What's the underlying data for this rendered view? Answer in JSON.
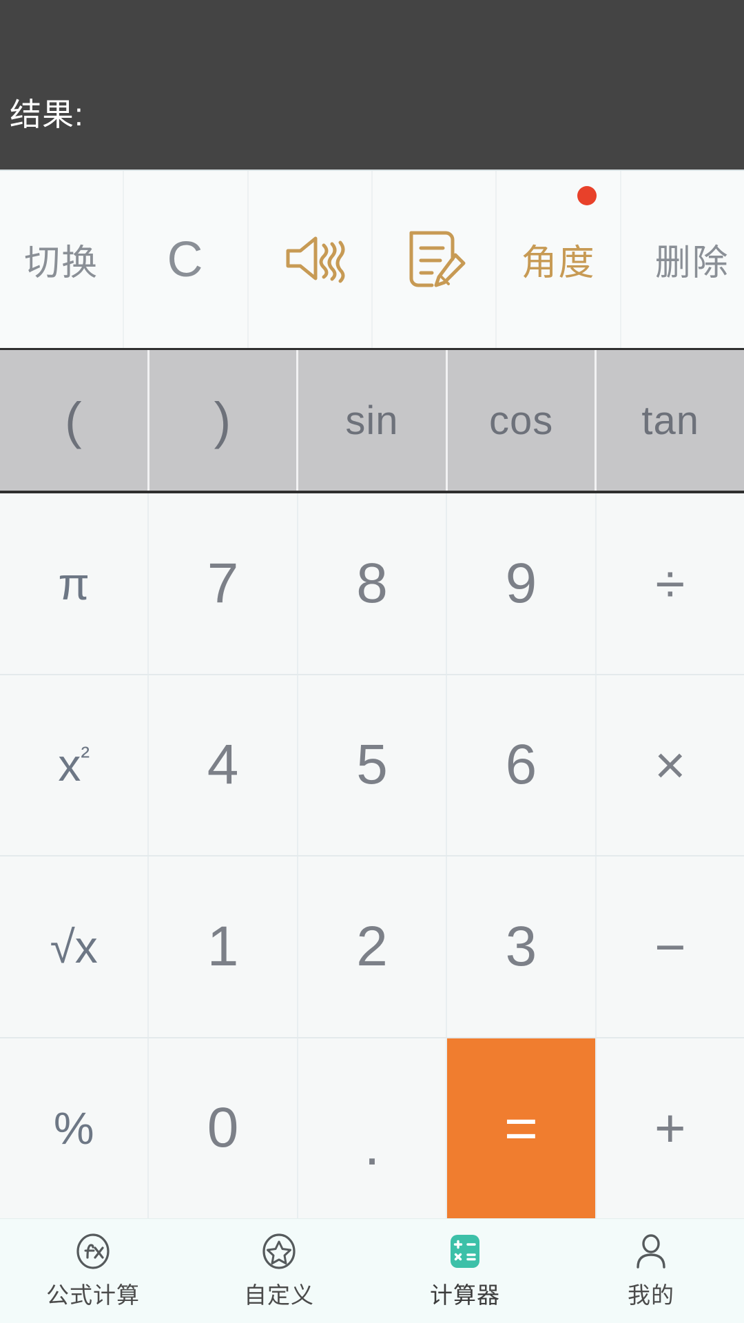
{
  "app": {
    "title": "计算器"
  },
  "display": {
    "expression": "",
    "result_label": "结果:"
  },
  "toolbar": {
    "items": [
      {
        "label": "切换",
        "type": "text",
        "icon": "",
        "style": "gray",
        "badge": false
      },
      {
        "label": "C",
        "type": "text",
        "icon": "",
        "style": "clear",
        "badge": false
      },
      {
        "label": "",
        "type": "icon",
        "icon": "sound-icon",
        "style": "gold",
        "badge": false
      },
      {
        "label": "",
        "type": "icon",
        "icon": "note-edit-icon",
        "style": "gold",
        "badge": false
      },
      {
        "label": "角度",
        "type": "text",
        "icon": "",
        "style": "gold",
        "badge": true
      },
      {
        "label": "删除",
        "type": "text",
        "icon": "",
        "style": "delete",
        "badge": false
      }
    ]
  },
  "function_row": {
    "keys": [
      {
        "label": "(",
        "name": "paren-open"
      },
      {
        "label": ")",
        "name": "paren-close"
      },
      {
        "label": "sin",
        "name": "sin"
      },
      {
        "label": "cos",
        "name": "cos"
      },
      {
        "label": "tan",
        "name": "tan"
      }
    ]
  },
  "keypad": {
    "rows": [
      [
        {
          "label": "π",
          "name": "pi",
          "kind": "fn"
        },
        {
          "label": "7",
          "name": "digit-7",
          "kind": "num"
        },
        {
          "label": "8",
          "name": "digit-8",
          "kind": "num"
        },
        {
          "label": "9",
          "name": "digit-9",
          "kind": "num"
        },
        {
          "label": "÷",
          "name": "divide",
          "kind": "op"
        }
      ],
      [
        {
          "label": "x²",
          "name": "square",
          "kind": "fn"
        },
        {
          "label": "4",
          "name": "digit-4",
          "kind": "num"
        },
        {
          "label": "5",
          "name": "digit-5",
          "kind": "num"
        },
        {
          "label": "6",
          "name": "digit-6",
          "kind": "num"
        },
        {
          "label": "×",
          "name": "multiply",
          "kind": "op"
        }
      ],
      [
        {
          "label": "√x",
          "name": "square-root",
          "kind": "fn"
        },
        {
          "label": "1",
          "name": "digit-1",
          "kind": "num"
        },
        {
          "label": "2",
          "name": "digit-2",
          "kind": "num"
        },
        {
          "label": "3",
          "name": "digit-3",
          "kind": "num"
        },
        {
          "label": "−",
          "name": "minus",
          "kind": "op"
        }
      ],
      [
        {
          "label": "%",
          "name": "percent",
          "kind": "fn"
        },
        {
          "label": "0",
          "name": "digit-0",
          "kind": "num"
        },
        {
          "label": ".",
          "name": "decimal-point",
          "kind": "dot"
        },
        {
          "label": "=",
          "name": "equals",
          "kind": "equals"
        },
        {
          "label": "+",
          "name": "plus",
          "kind": "op"
        }
      ]
    ]
  },
  "bottom_nav": {
    "items": [
      {
        "label": "公式计算",
        "icon": "fx-circle-icon",
        "active": false
      },
      {
        "label": "自定义",
        "icon": "star-circle-icon",
        "active": false
      },
      {
        "label": "计算器",
        "icon": "calculator-icon",
        "active": true
      },
      {
        "label": "我的",
        "icon": "person-icon",
        "active": false
      }
    ]
  },
  "colors": {
    "display_bg": "#444444",
    "accent_orange": "#f07d2f",
    "accent_teal": "#3cc0a8",
    "gold": "#c79a54",
    "badge_red": "#e8412a",
    "func_row_bg": "#c6c6c8",
    "key_bg": "#f6f8f8",
    "nav_bg": "#f3fbfa",
    "text_gray": "#7c8088"
  }
}
